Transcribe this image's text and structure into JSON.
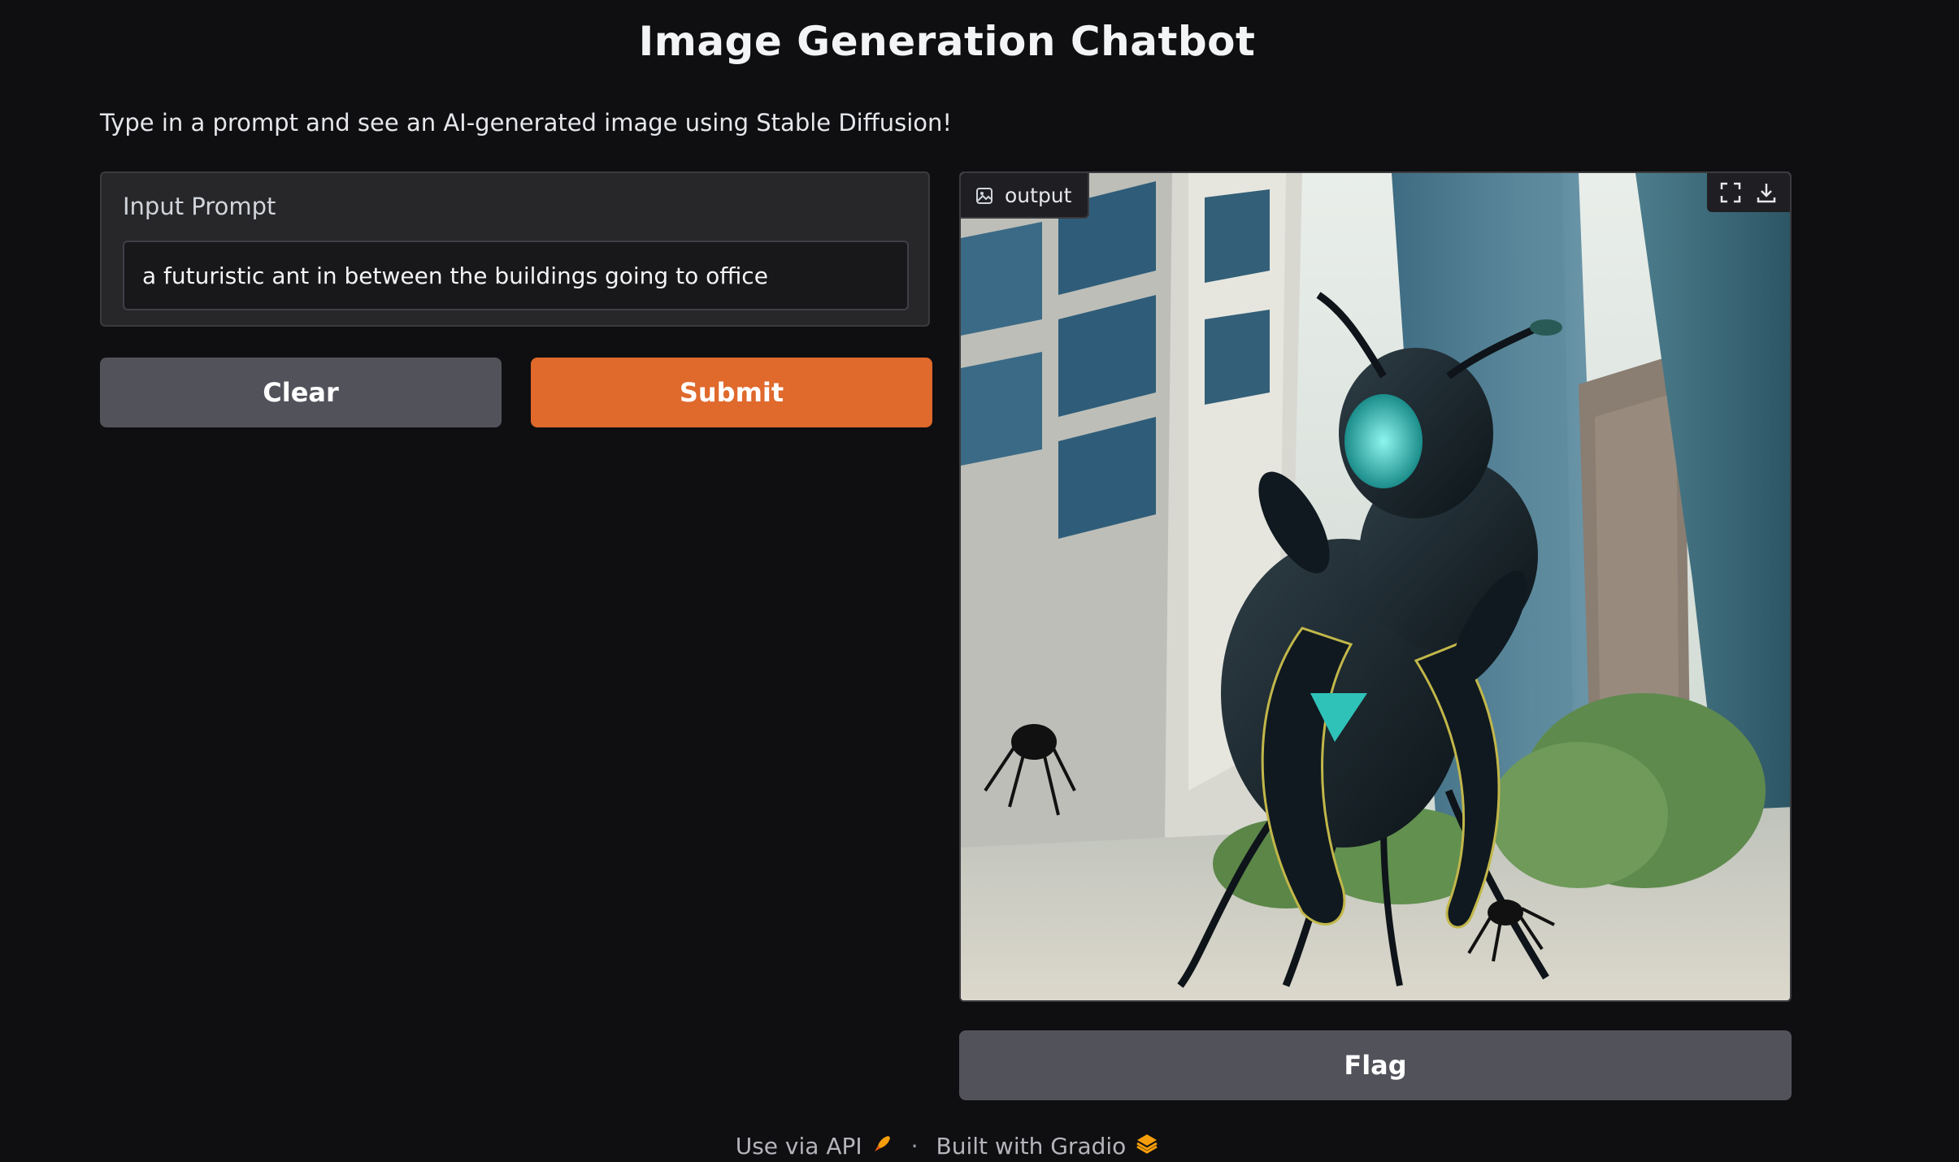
{
  "title": "Image Generation Chatbot",
  "description": "Type in a prompt and see an AI-generated image using Stable Diffusion!",
  "input": {
    "label": "Input Prompt",
    "value": "a futuristic ant in between the buildings going to office"
  },
  "buttons": {
    "clear": "Clear",
    "submit": "Submit",
    "flag": "Flag"
  },
  "output": {
    "label": "output",
    "icons": [
      "image-icon",
      "fullscreen-icon",
      "download-icon"
    ]
  },
  "footer": {
    "api_link": "Use via API",
    "separator": "·",
    "built_with": "Built with Gradio"
  },
  "colors": {
    "background": "#0f0f11",
    "panel": "#27272a",
    "secondary_button": "#52525b",
    "primary_button": "#e0692c"
  }
}
